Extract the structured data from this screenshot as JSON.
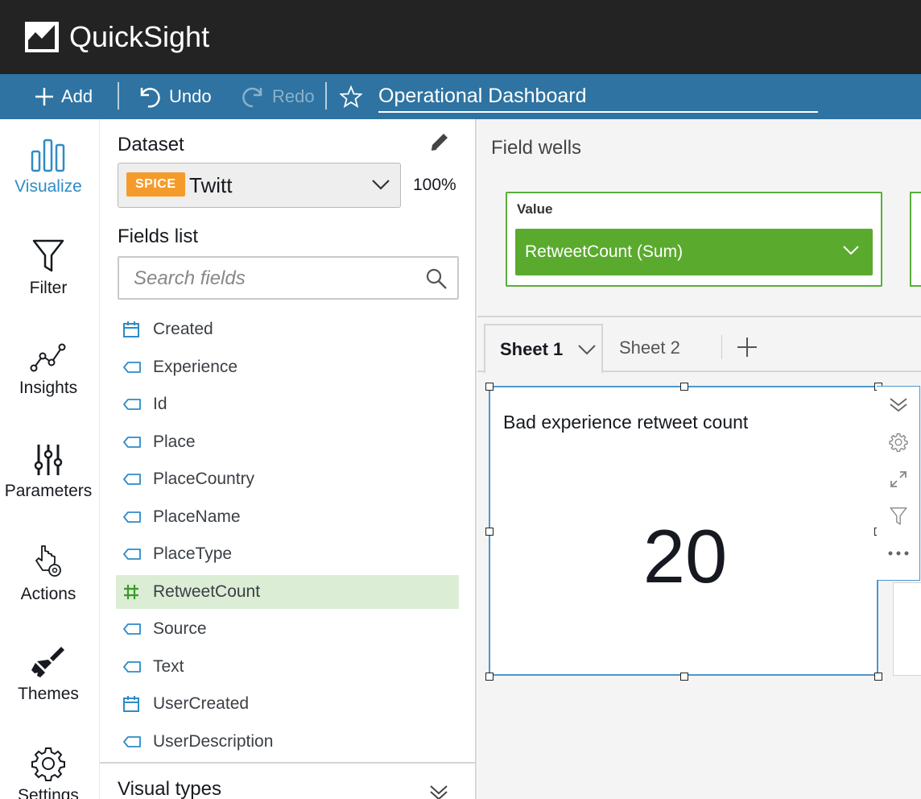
{
  "app": {
    "name": "QuickSight"
  },
  "toolbar": {
    "add_label": "Add",
    "undo_label": "Undo",
    "redo_label": "Redo",
    "dashboard_title": "Operational Dashboard"
  },
  "nav": {
    "items": [
      {
        "label": "Visualize",
        "icon": "bar-chart-icon",
        "active": true
      },
      {
        "label": "Filter",
        "icon": "funnel-icon"
      },
      {
        "label": "Insights",
        "icon": "line-graph-icon"
      },
      {
        "label": "Parameters",
        "icon": "sliders-icon"
      },
      {
        "label": "Actions",
        "icon": "pointer-gear-icon"
      },
      {
        "label": "Themes",
        "icon": "brush-icon"
      },
      {
        "label": "Settings",
        "icon": "gear-icon"
      }
    ]
  },
  "dataset": {
    "section_title": "Dataset",
    "badge": "SPICE",
    "name": "Twitt",
    "percent": "100%"
  },
  "fields": {
    "section_title": "Fields list",
    "search_placeholder": "Search fields",
    "items": [
      {
        "name": "Created",
        "type": "date"
      },
      {
        "name": "Experience",
        "type": "dimension"
      },
      {
        "name": "Id",
        "type": "dimension"
      },
      {
        "name": "Place",
        "type": "dimension"
      },
      {
        "name": "PlaceCountry",
        "type": "dimension"
      },
      {
        "name": "PlaceName",
        "type": "dimension"
      },
      {
        "name": "PlaceType",
        "type": "dimension"
      },
      {
        "name": "RetweetCount",
        "type": "measure",
        "selected": true
      },
      {
        "name": "Source",
        "type": "dimension"
      },
      {
        "name": "Text",
        "type": "dimension"
      },
      {
        "name": "UserCreated",
        "type": "date"
      },
      {
        "name": "UserDescription",
        "type": "dimension"
      }
    ]
  },
  "visual_types": {
    "title": "Visual types"
  },
  "field_wells": {
    "title": "Field wells",
    "value_label": "Value",
    "value_field": "RetweetCount (Sum)"
  },
  "sheets": {
    "tabs": [
      "Sheet 1",
      "Sheet 2"
    ]
  },
  "visual": {
    "title": "Bad experience retweet count",
    "value": "20"
  },
  "colors": {
    "topbar": "#232323",
    "toolbar": "#2e73a1",
    "accent": "#2e8bc7",
    "spice": "#f59b2b",
    "well_green": "#5aaa2e",
    "selected_row": "#dcedd5"
  }
}
